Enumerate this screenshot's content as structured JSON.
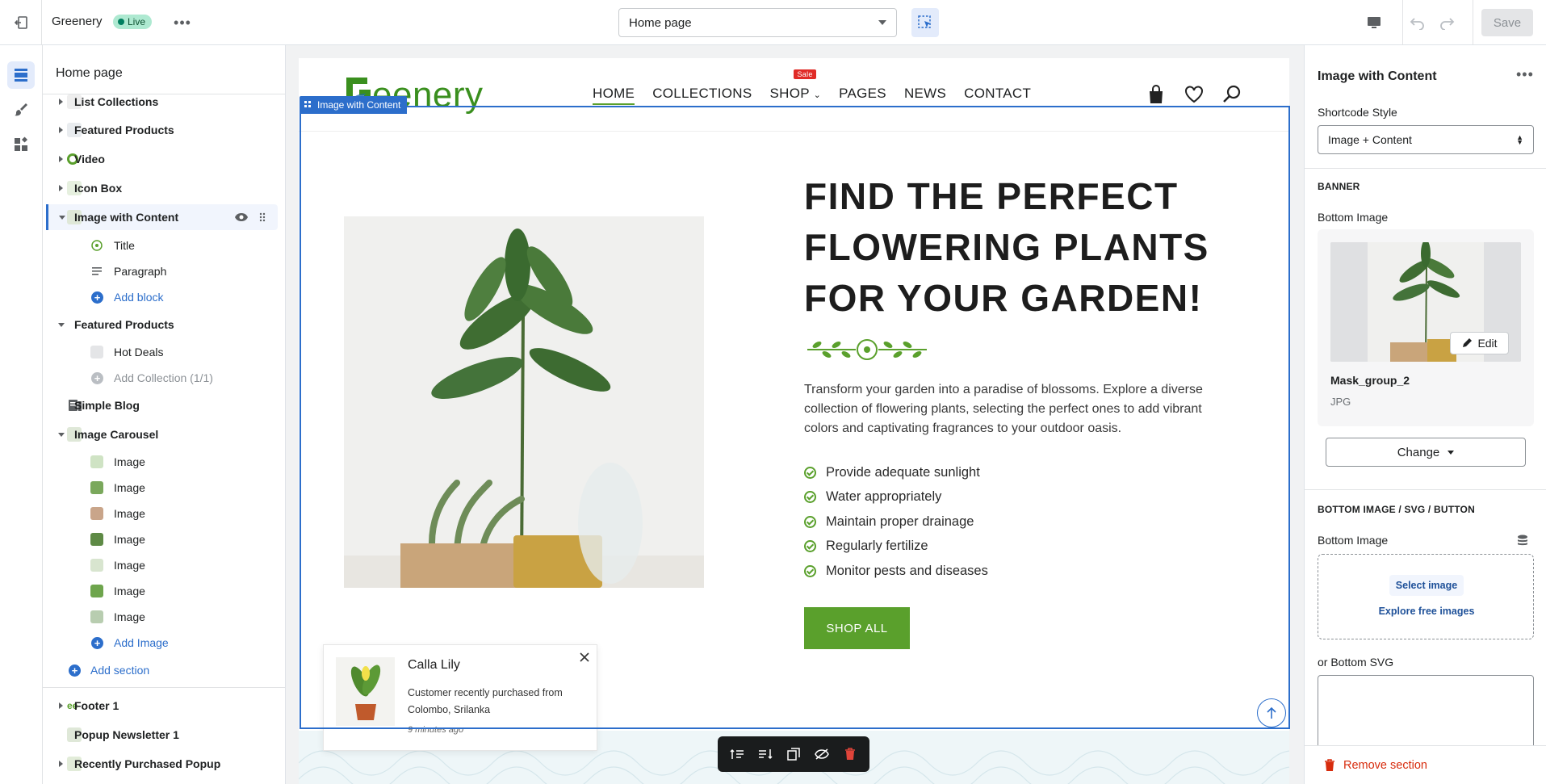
{
  "topbar": {
    "store_name": "Greenery",
    "status_badge": "Live",
    "page_select": "Home page",
    "save_label": "Save"
  },
  "sidebar": {
    "title": "Home page",
    "items": [
      {
        "label": "List Collections"
      },
      {
        "label": "Featured Products"
      },
      {
        "label": "Video"
      },
      {
        "label": "Icon Box"
      },
      {
        "label": "Image with Content"
      },
      {
        "label": "Title"
      },
      {
        "label": "Paragraph"
      },
      {
        "label": "Add block"
      },
      {
        "label": "Featured Products"
      },
      {
        "label": "Hot Deals"
      },
      {
        "label": "Add Collection (1/1)"
      },
      {
        "label": "Simple Blog"
      },
      {
        "label": "Image Carousel"
      },
      {
        "label": "Image"
      },
      {
        "label": "Image"
      },
      {
        "label": "Image"
      },
      {
        "label": "Image"
      },
      {
        "label": "Image"
      },
      {
        "label": "Image"
      },
      {
        "label": "Image"
      },
      {
        "label": "Add Image"
      },
      {
        "label": "Add section"
      },
      {
        "label": "Footer 1"
      },
      {
        "label": "Popup Newsletter 1"
      },
      {
        "label": "Recently Purchased Popup"
      }
    ]
  },
  "preview": {
    "logo_text": "eenery",
    "section_tag": "Image with Content",
    "nav": [
      "HOME",
      "COLLECTIONS",
      "SHOP",
      "PAGES",
      "NEWS",
      "CONTACT"
    ],
    "sale_badge": "Sale",
    "hero_title": "FIND THE PERFECT FLOWERING PLANTS FOR YOUR GARDEN!",
    "hero_paragraph": "Transform your garden into a paradise of blossoms. Explore a diverse collection of flowering plants, selecting the perfect ones to add vibrant colors and captivating fragrances to your outdoor oasis.",
    "checklist": [
      "Provide adequate sunlight",
      "Water appropriately",
      "Maintain proper drainage",
      "Regularly fertilize",
      "Monitor pests and diseases"
    ],
    "shop_button": "SHOP ALL",
    "popup": {
      "product": "Calla Lily",
      "message": "Customer recently purchased  from Colombo, Srilanka",
      "time": "9 minutes ago"
    }
  },
  "panel": {
    "title": "Image with Content",
    "shortcode_label": "Shortcode Style",
    "shortcode_value": "Image + Content",
    "banner_heading": "BANNER",
    "bottom_image_label": "Bottom Image",
    "edit_label": "Edit",
    "image_name": "Mask_group_2",
    "image_type": "JPG",
    "change_label": "Change",
    "section2_heading": "BOTTOM IMAGE / SVG / BUTTON",
    "bottom_image_label2": "Bottom Image",
    "select_image": "Select image",
    "explore_images": "Explore free images",
    "bottom_svg_label": "or Bottom SVG",
    "remove_section": "Remove section"
  },
  "colors": {
    "accent": "#2c6ecb",
    "brand_green": "#5aa02c",
    "danger": "#d72c0d"
  }
}
